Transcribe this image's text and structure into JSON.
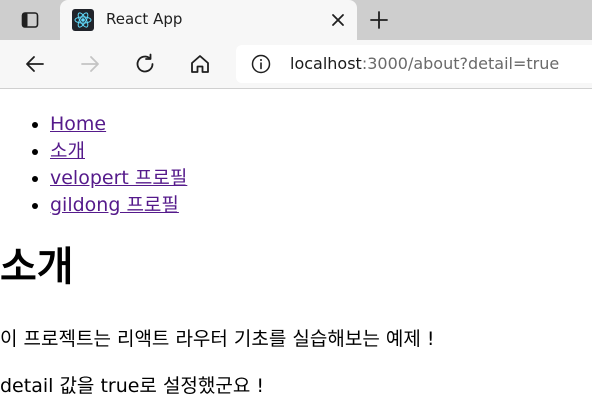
{
  "browser": {
    "tab": {
      "title": "React App",
      "favicon": "react-icon"
    },
    "address_bar": {
      "host": "localhost",
      "path": ":3000/about?detail=true"
    },
    "icons": {
      "tab_actions": "tab-actions-icon",
      "close": "close-icon",
      "new_tab": "plus-icon",
      "back": "back-arrow-icon",
      "forward": "forward-arrow-icon",
      "refresh": "refresh-icon",
      "home": "home-icon",
      "site_info": "info-icon"
    }
  },
  "nav": {
    "items": [
      {
        "label": "Home"
      },
      {
        "label": "소개"
      },
      {
        "label": "velopert 프로필"
      },
      {
        "label": "gildong 프로필"
      }
    ]
  },
  "content": {
    "title": "소개",
    "description": "이 프로젝트는 리액트 라우터 기초를 실습해보는 예제 !",
    "detail_text": "detail 값을 true로 설정했군요 !"
  },
  "colors": {
    "link": "#551a8b",
    "tabstrip": "#cecece",
    "toolbar": "#f7f7f7",
    "react": "#61dafb"
  }
}
